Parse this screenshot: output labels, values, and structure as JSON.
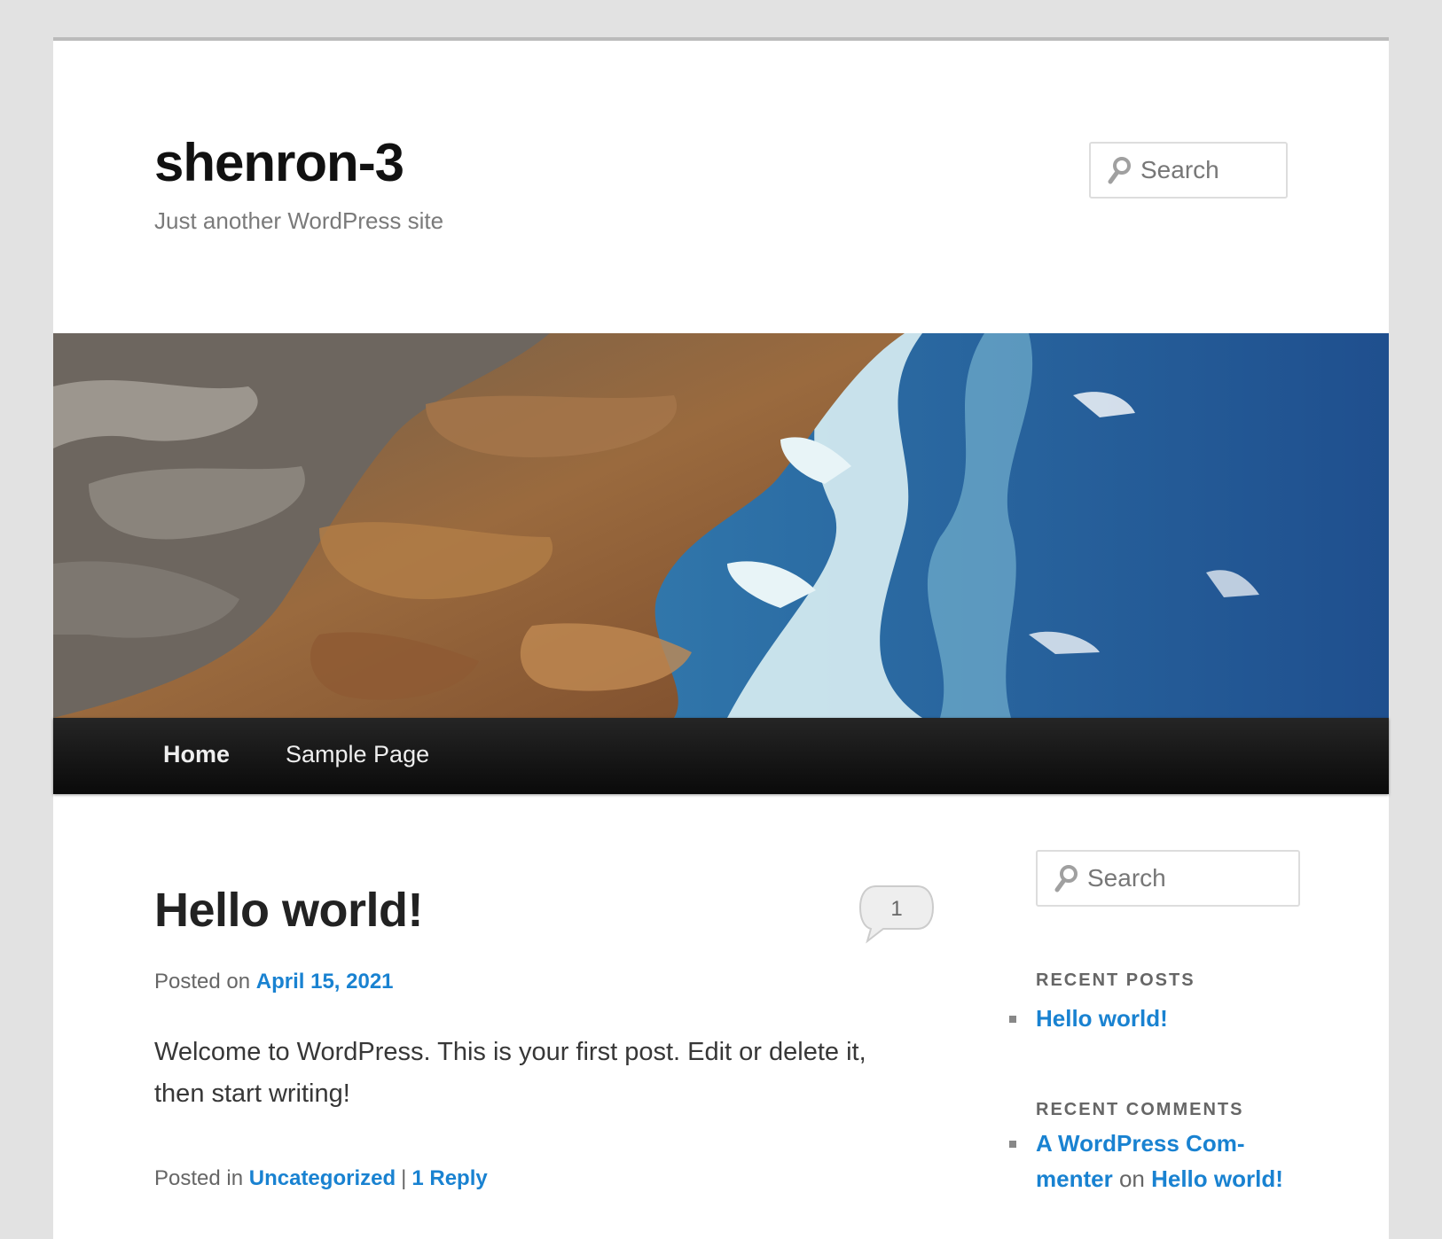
{
  "site": {
    "title": "shenron-3",
    "description": "Just another WordPress site"
  },
  "header_search": {
    "placeholder": "Search",
    "icon": "search-icon"
  },
  "header_image": {
    "subject": "rocky coastline with ocean waves"
  },
  "nav": {
    "home": "Home",
    "sample_page": "Sample Page"
  },
  "post": {
    "title": "Hello world!",
    "comment_count": "1",
    "posted_on_label": "Posted on",
    "date": "April 15, 2021",
    "content": "Welcome to WordPress. This is your first post. Edit or delete it, then start writing!",
    "posted_in_label": "Posted in",
    "category": "Uncategorized",
    "separator": "|",
    "reply_link": "1 Reply"
  },
  "sidebar": {
    "search_placeholder": "Search",
    "recent_posts_title": "RECENT POSTS",
    "recent_posts": [
      "Hello world!"
    ],
    "recent_comments_title": "RECENT COMMENTS",
    "recent_comments": [
      {
        "author": "A WordPress Com-menter",
        "on": "on",
        "post": "Hello world!"
      }
    ]
  },
  "colors": {
    "link": "#1982d1",
    "background": "#e2e2e2",
    "nav_bar": "#111111"
  }
}
